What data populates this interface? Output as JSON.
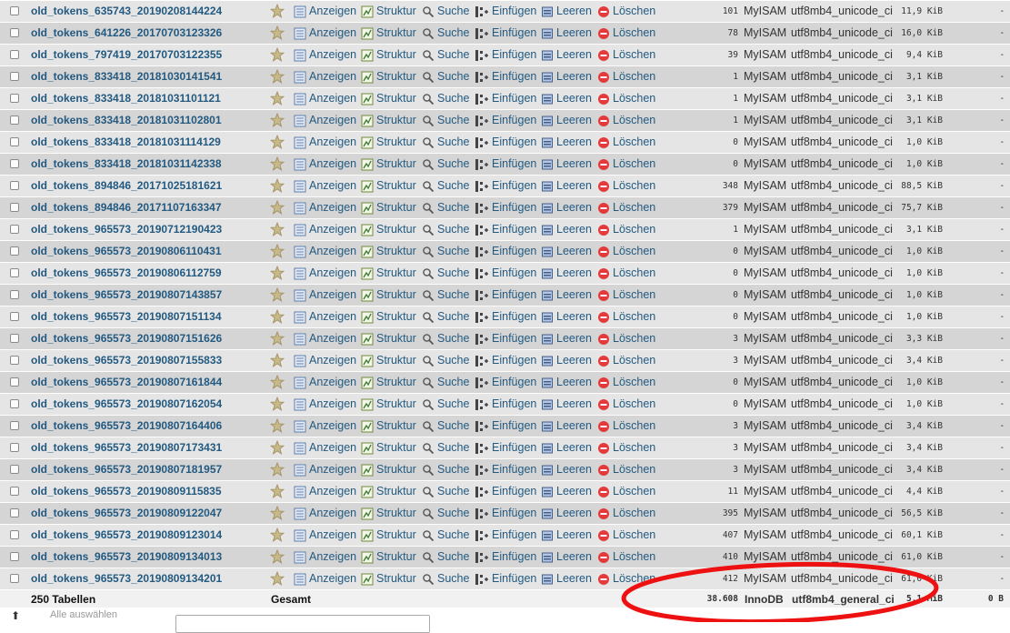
{
  "actions": [
    "Anzeigen",
    "Struktur",
    "Suche",
    "Einfügen",
    "Leeren",
    "Löschen"
  ],
  "colors": {
    "link": "#235a81",
    "row_odd": "#e5e5e5",
    "row_even": "#d5d5d5",
    "star": "#c8b98a",
    "drop": "#e53a3a",
    "highlight": "#ee1111"
  },
  "icons": [
    "checkbox",
    "star-icon",
    "browse-icon",
    "structure-icon",
    "search-icon",
    "insert-icon",
    "empty-icon",
    "drop-icon"
  ],
  "rows": [
    {
      "name": "old_tokens_635743_20190208144224",
      "rows": "101",
      "engine": "MyISAM",
      "collation": "utf8mb4_unicode_ci",
      "size": "11,9 KiB",
      "overhead": "-"
    },
    {
      "name": "old_tokens_641226_20170703123326",
      "rows": "78",
      "engine": "MyISAM",
      "collation": "utf8mb4_unicode_ci",
      "size": "16,0 KiB",
      "overhead": "-"
    },
    {
      "name": "old_tokens_797419_20170703122355",
      "rows": "39",
      "engine": "MyISAM",
      "collation": "utf8mb4_unicode_ci",
      "size": "9,4 KiB",
      "overhead": "-"
    },
    {
      "name": "old_tokens_833418_20181030141541",
      "rows": "1",
      "engine": "MyISAM",
      "collation": "utf8mb4_unicode_ci",
      "size": "3,1 KiB",
      "overhead": "-"
    },
    {
      "name": "old_tokens_833418_20181031101121",
      "rows": "1",
      "engine": "MyISAM",
      "collation": "utf8mb4_unicode_ci",
      "size": "3,1 KiB",
      "overhead": "-"
    },
    {
      "name": "old_tokens_833418_20181031102801",
      "rows": "1",
      "engine": "MyISAM",
      "collation": "utf8mb4_unicode_ci",
      "size": "3,1 KiB",
      "overhead": "-"
    },
    {
      "name": "old_tokens_833418_20181031114129",
      "rows": "0",
      "engine": "MyISAM",
      "collation": "utf8mb4_unicode_ci",
      "size": "1,0 KiB",
      "overhead": "-"
    },
    {
      "name": "old_tokens_833418_20181031142338",
      "rows": "0",
      "engine": "MyISAM",
      "collation": "utf8mb4_unicode_ci",
      "size": "1,0 KiB",
      "overhead": "-"
    },
    {
      "name": "old_tokens_894846_20171025181621",
      "rows": "348",
      "engine": "MyISAM",
      "collation": "utf8mb4_unicode_ci",
      "size": "88,5 KiB",
      "overhead": "-"
    },
    {
      "name": "old_tokens_894846_20171107163347",
      "rows": "379",
      "engine": "MyISAM",
      "collation": "utf8mb4_unicode_ci",
      "size": "75,7 KiB",
      "overhead": "-"
    },
    {
      "name": "old_tokens_965573_20190712190423",
      "rows": "1",
      "engine": "MyISAM",
      "collation": "utf8mb4_unicode_ci",
      "size": "3,1 KiB",
      "overhead": "-"
    },
    {
      "name": "old_tokens_965573_20190806110431",
      "rows": "0",
      "engine": "MyISAM",
      "collation": "utf8mb4_unicode_ci",
      "size": "1,0 KiB",
      "overhead": "-"
    },
    {
      "name": "old_tokens_965573_20190806112759",
      "rows": "0",
      "engine": "MyISAM",
      "collation": "utf8mb4_unicode_ci",
      "size": "1,0 KiB",
      "overhead": "-"
    },
    {
      "name": "old_tokens_965573_20190807143857",
      "rows": "0",
      "engine": "MyISAM",
      "collation": "utf8mb4_unicode_ci",
      "size": "1,0 KiB",
      "overhead": "-"
    },
    {
      "name": "old_tokens_965573_20190807151134",
      "rows": "0",
      "engine": "MyISAM",
      "collation": "utf8mb4_unicode_ci",
      "size": "1,0 KiB",
      "overhead": "-"
    },
    {
      "name": "old_tokens_965573_20190807151626",
      "rows": "3",
      "engine": "MyISAM",
      "collation": "utf8mb4_unicode_ci",
      "size": "3,3 KiB",
      "overhead": "-"
    },
    {
      "name": "old_tokens_965573_20190807155833",
      "rows": "3",
      "engine": "MyISAM",
      "collation": "utf8mb4_unicode_ci",
      "size": "3,4 KiB",
      "overhead": "-"
    },
    {
      "name": "old_tokens_965573_20190807161844",
      "rows": "0",
      "engine": "MyISAM",
      "collation": "utf8mb4_unicode_ci",
      "size": "1,0 KiB",
      "overhead": "-"
    },
    {
      "name": "old_tokens_965573_20190807162054",
      "rows": "0",
      "engine": "MyISAM",
      "collation": "utf8mb4_unicode_ci",
      "size": "1,0 KiB",
      "overhead": "-"
    },
    {
      "name": "old_tokens_965573_20190807164406",
      "rows": "3",
      "engine": "MyISAM",
      "collation": "utf8mb4_unicode_ci",
      "size": "3,4 KiB",
      "overhead": "-"
    },
    {
      "name": "old_tokens_965573_20190807173431",
      "rows": "3",
      "engine": "MyISAM",
      "collation": "utf8mb4_unicode_ci",
      "size": "3,4 KiB",
      "overhead": "-"
    },
    {
      "name": "old_tokens_965573_20190807181957",
      "rows": "3",
      "engine": "MyISAM",
      "collation": "utf8mb4_unicode_ci",
      "size": "3,4 KiB",
      "overhead": "-"
    },
    {
      "name": "old_tokens_965573_20190809115835",
      "rows": "11",
      "engine": "MyISAM",
      "collation": "utf8mb4_unicode_ci",
      "size": "4,4 KiB",
      "overhead": "-"
    },
    {
      "name": "old_tokens_965573_20190809122047",
      "rows": "395",
      "engine": "MyISAM",
      "collation": "utf8mb4_unicode_ci",
      "size": "56,5 KiB",
      "overhead": "-"
    },
    {
      "name": "old_tokens_965573_20190809123014",
      "rows": "407",
      "engine": "MyISAM",
      "collation": "utf8mb4_unicode_ci",
      "size": "60,1 KiB",
      "overhead": "-"
    },
    {
      "name": "old_tokens_965573_20190809134013",
      "rows": "410",
      "engine": "MyISAM",
      "collation": "utf8mb4_unicode_ci",
      "size": "61,0 KiB",
      "overhead": "-"
    },
    {
      "name": "old_tokens_965573_20190809134201",
      "rows": "412",
      "engine": "MyISAM",
      "collation": "utf8mb4_unicode_ci",
      "size": "61,0 KiB",
      "overhead": "-"
    }
  ],
  "footer": {
    "tables_label": "250 Tabellen",
    "total_label": "Gesamt",
    "rows_total": "38.608",
    "engine": "InnoDB",
    "collation": "utf8mb4_general_ci",
    "size_total": "5,1 MiB",
    "overhead_total": "0 B"
  },
  "below": {
    "arrow": "⬆",
    "select_all_label": "Alle auswählen"
  }
}
